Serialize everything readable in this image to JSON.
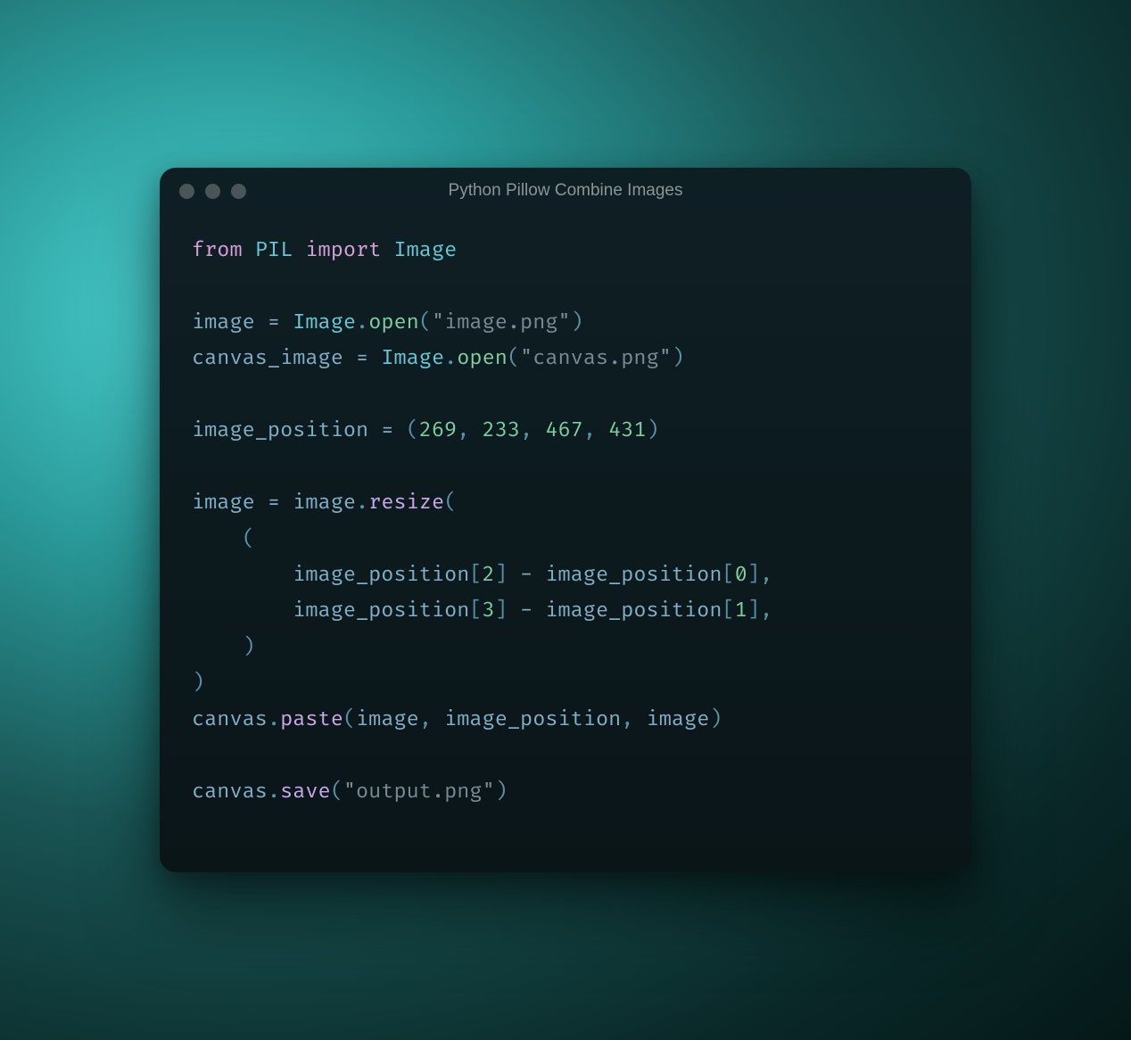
{
  "window": {
    "title": "Python Pillow Combine Images"
  },
  "code": {
    "line1": {
      "from": "from",
      "pil": "PIL",
      "import": "import",
      "image": "Image"
    },
    "line3": {
      "image_var": "image",
      "equals": " = ",
      "image_cls": "Image",
      "dot": ".",
      "open": "open",
      "paren_open": "(",
      "str": "\"image.png\"",
      "paren_close": ")"
    },
    "line4": {
      "canvas_var": "canvas_image",
      "equals": " = ",
      "image_cls": "Image",
      "dot": ".",
      "open": "open",
      "paren_open": "(",
      "str": "\"canvas.png\"",
      "paren_close": ")"
    },
    "line6": {
      "var": "image_position",
      "equals": " = ",
      "paren_open": "(",
      "n1": "269",
      "c1": ", ",
      "n2": "233",
      "c2": ", ",
      "n3": "467",
      "c3": ", ",
      "n4": "431",
      "paren_close": ")"
    },
    "line8": {
      "image_var": "image",
      "equals": " = ",
      "image_obj": "image",
      "dot": ".",
      "resize": "resize",
      "paren_open": "("
    },
    "line9": {
      "indent": "    ",
      "paren_open": "("
    },
    "line10": {
      "indent": "        ",
      "ip1": "image_position",
      "bracket_open1": "[",
      "idx1": "2",
      "bracket_close1": "]",
      "minus": " - ",
      "ip2": "image_position",
      "bracket_open2": "[",
      "idx2": "0",
      "bracket_close2": "]",
      "comma": ","
    },
    "line11": {
      "indent": "        ",
      "ip1": "image_position",
      "bracket_open1": "[",
      "idx1": "3",
      "bracket_close1": "]",
      "minus": " - ",
      "ip2": "image_position",
      "bracket_open2": "[",
      "idx2": "1",
      "bracket_close2": "]",
      "comma": ","
    },
    "line12": {
      "indent": "    ",
      "paren_close": ")"
    },
    "line13": {
      "paren_close": ")"
    },
    "line14": {
      "canvas": "canvas",
      "dot": ".",
      "paste": "paste",
      "paren_open": "(",
      "arg1": "image",
      "c1": ", ",
      "arg2": "image_position",
      "c2": ", ",
      "arg3": "image",
      "paren_close": ")"
    },
    "line16": {
      "canvas": "canvas",
      "dot": ".",
      "save": "save",
      "paren_open": "(",
      "str": "\"output.png\"",
      "paren_close": ")"
    }
  }
}
